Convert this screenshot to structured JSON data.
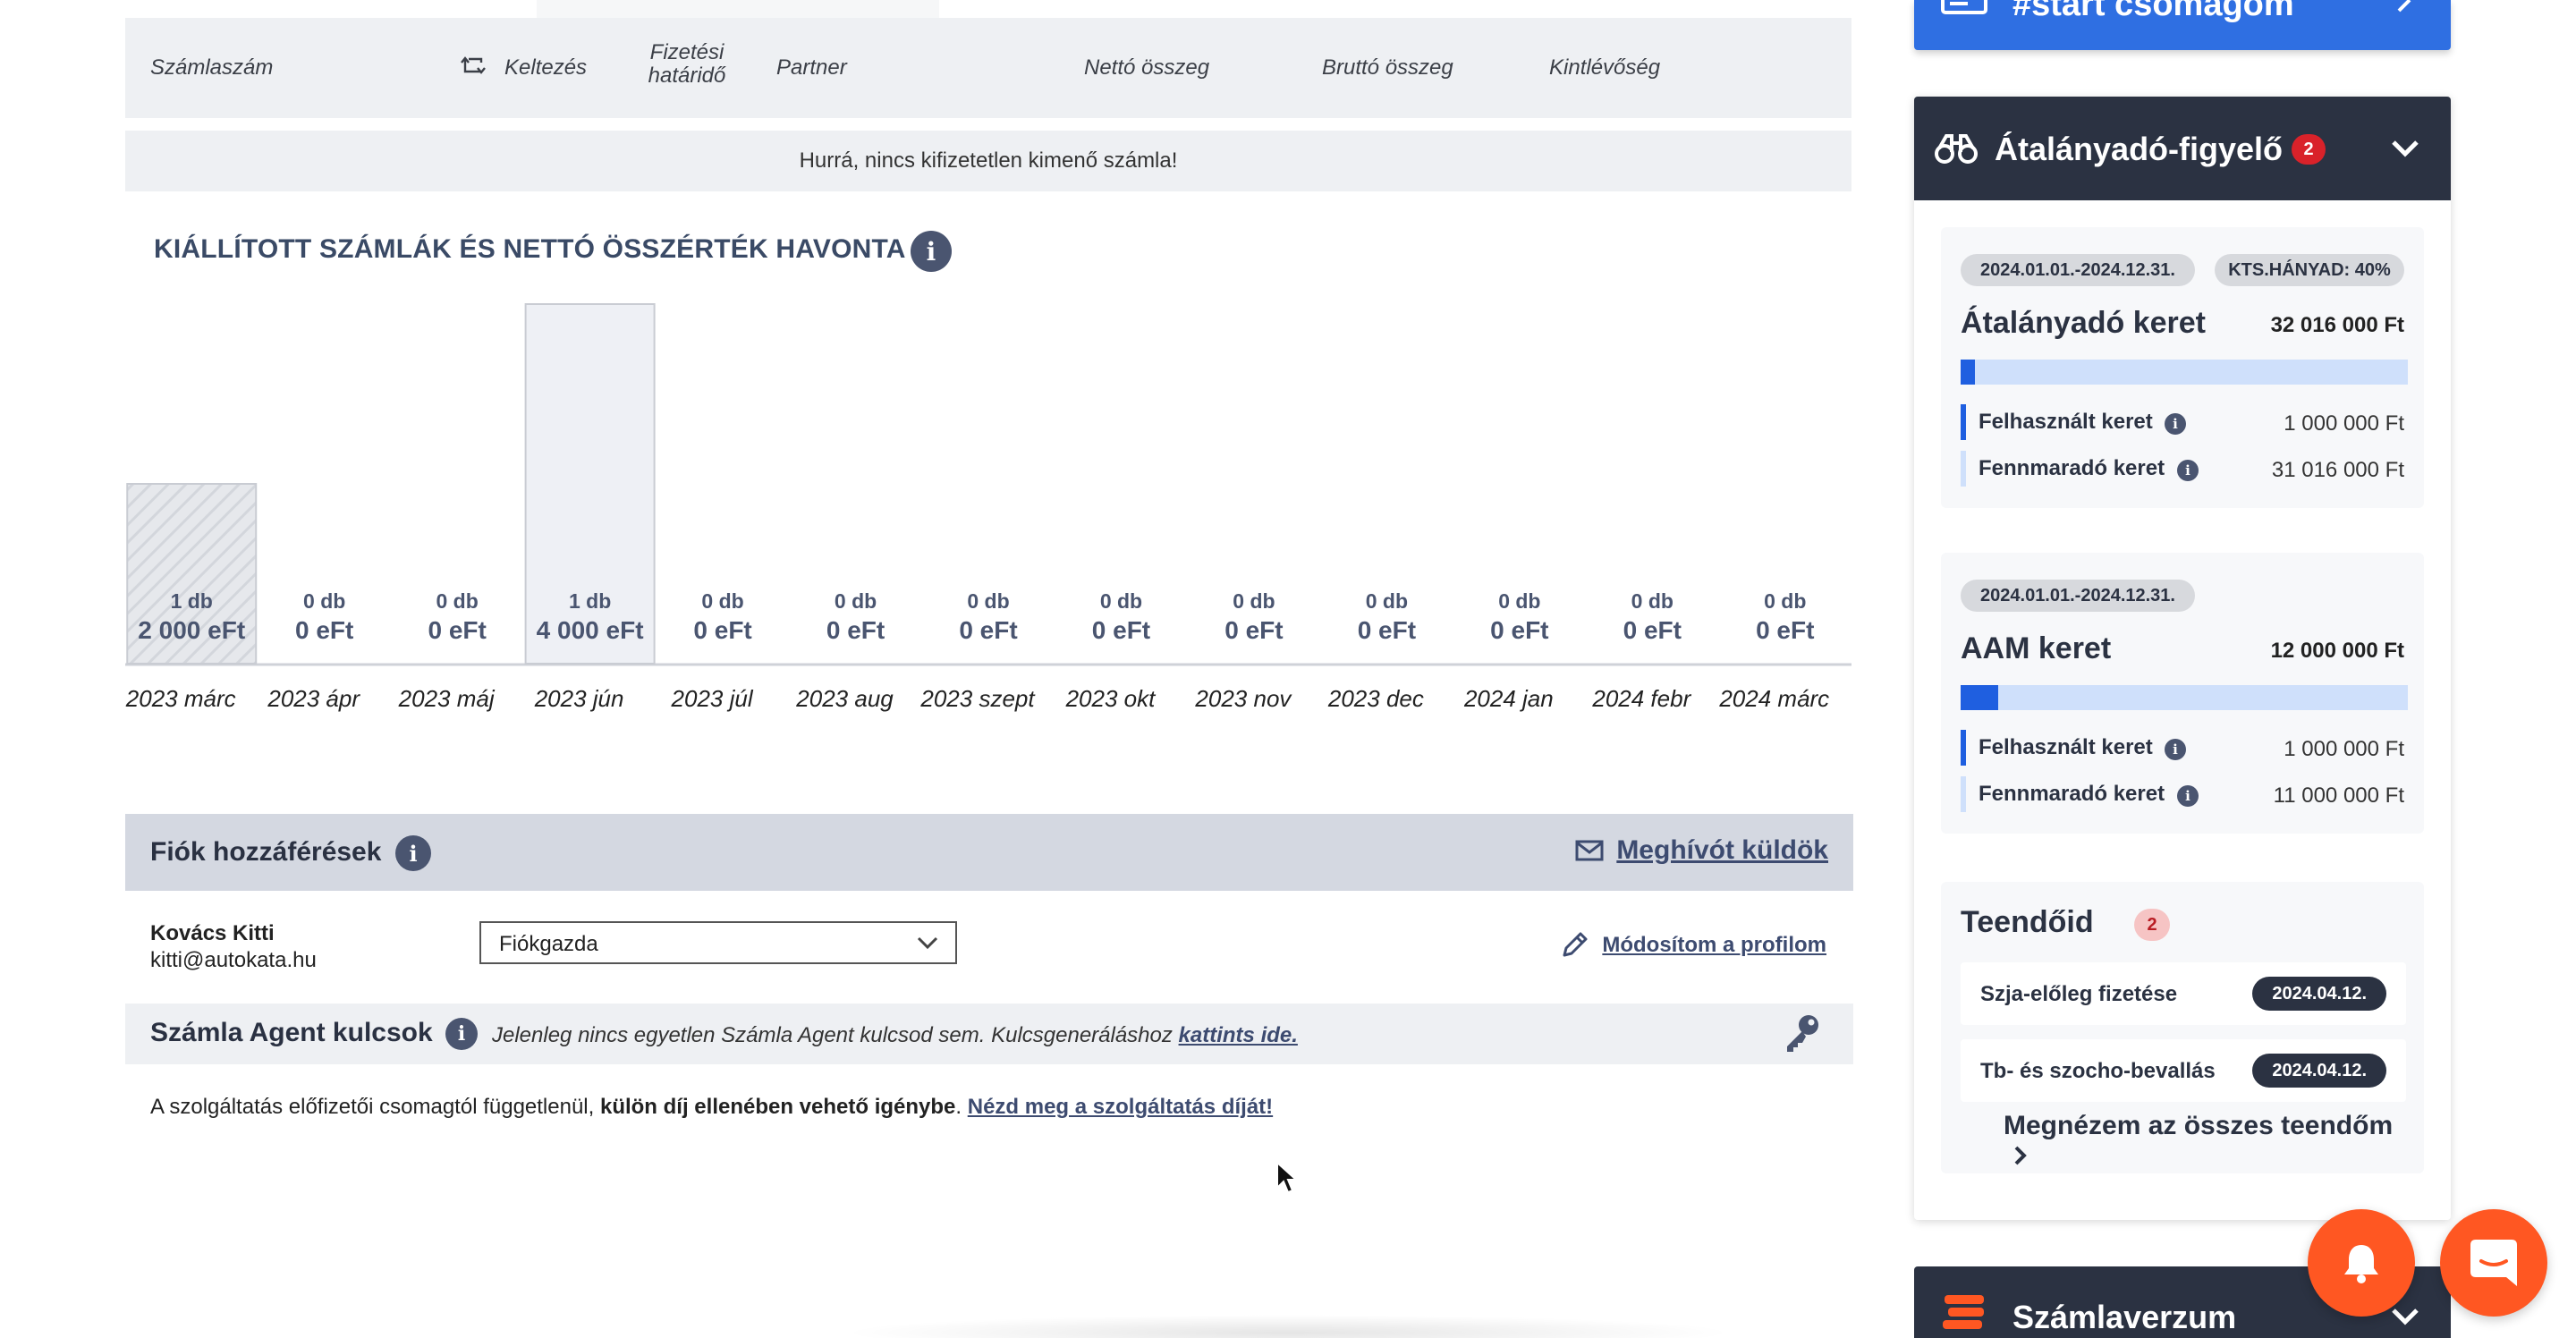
{
  "table": {
    "headers": {
      "invoice_number": "Számlaszám",
      "issue_date": "Keltezés",
      "due_date_line1": "Fizetési",
      "due_date_line2": "határidő",
      "partner": "Partner",
      "net_amount": "Nettó összeg",
      "gross_amount": "Bruttó összeg",
      "outstanding": "Kintlévőség"
    },
    "empty_message": "Hurrá, nincs kifizetetlen kimenő számla!"
  },
  "chart_section": {
    "title": "KIÁLLÍTOTT SZÁMLÁK ÉS NETTÓ ÖSSZÉRTÉK HAVONTA",
    "info_glyph": "i"
  },
  "chart_data": {
    "type": "bar",
    "categories": [
      "2023 márc",
      "2023 ápr",
      "2023 máj",
      "2023 jún",
      "2023 júl",
      "2023 aug",
      "2023 szept",
      "2023 okt",
      "2023 nov",
      "2023 dec",
      "2024 jan",
      "2024 febr",
      "2024 márc"
    ],
    "series": [
      {
        "values": [
          2000,
          0,
          0,
          4000,
          0,
          0,
          0,
          0,
          0,
          0,
          0,
          0,
          0
        ],
        "value_labels": [
          "2 000 eFt",
          "0 eFt",
          "0 eFt",
          "4 000 eFt",
          "0 eFt",
          "0 eFt",
          "0 eFt",
          "0 eFt",
          "0 eFt",
          "0 eFt",
          "0 eFt",
          "0 eFt",
          "0 eFt"
        ],
        "counts": [
          1,
          0,
          0,
          1,
          0,
          0,
          0,
          0,
          0,
          0,
          0,
          0,
          0
        ],
        "count_labels": [
          "1 db",
          "0 db",
          "0 db",
          "1 db",
          "0 db",
          "0 db",
          "0 db",
          "0 db",
          "0 db",
          "0 db",
          "0 db",
          "0 db",
          "0 db"
        ]
      }
    ],
    "ylim": [
      0,
      4000
    ],
    "grid": false,
    "bar_colors": {
      "hatched": "#e6e8ec",
      "plain": "#eef0f5",
      "border": "#c9ccd3"
    }
  },
  "access": {
    "title": "Fiók hozzáférések",
    "invite_label": "Meghívót küldök",
    "user_name": "Kovács Kitti",
    "user_email": "kitti@autokata.hu",
    "role_value": "Fiókgazda",
    "edit_profile": "Módosítom a profilom"
  },
  "agent_keys": {
    "title": "Számla Agent kulcsok",
    "text": "Jelenleg nincs egyetlen Számla Agent kulcsod sem. Kulcsgeneráláshoz ",
    "link": "kattints ide."
  },
  "service": {
    "text_before": "A szolgáltatás előfizetői csomagtól függetlenül, ",
    "text_bold": "külön díj ellenében vehető igénybe",
    "text_after": ". ",
    "link": "Nézd meg a szolgáltatás díját!"
  },
  "sidebar": {
    "start_label": "#start csomagom",
    "monitor_title": "Átalányadó-figyelő",
    "monitor_count": "2",
    "card1": {
      "period": "2024.01.01.-2024.12.31.",
      "cost_ratio": "KTS.HÁNYAD: 40%",
      "title": "Átalányadó keret",
      "amount": "32 016 000 Ft",
      "used_fraction": 0.031,
      "used_label": "Felhasznált keret",
      "used_value": "1 000 000 Ft",
      "remaining_label": "Fennmaradó keret",
      "remaining_value": "31 016 000 Ft"
    },
    "card2": {
      "period": "2024.01.01.-2024.12.31.",
      "title": "AAM keret",
      "amount": "12 000 000 Ft",
      "used_fraction": 0.083,
      "used_label": "Felhasznált keret",
      "used_value": "1 000 000 Ft",
      "remaining_label": "Fennmaradó keret",
      "remaining_value": "11 000 000 Ft"
    },
    "todos": {
      "title": "Teendőid",
      "count": "2",
      "items": [
        {
          "label": "Szja-előleg fizetése",
          "date": "2024.04.12."
        },
        {
          "label": "Tb- és szocho-bevallás",
          "date": "2024.04.12."
        }
      ],
      "see_all": "Megnézem az összes teendőm"
    },
    "bottom_title": "Számlaverzum"
  },
  "colors": {
    "accent_blue": "#2f6fe2",
    "dark_navy": "#2b3242",
    "fab_orange": "#ff5722",
    "alert_red": "#d9222a"
  }
}
